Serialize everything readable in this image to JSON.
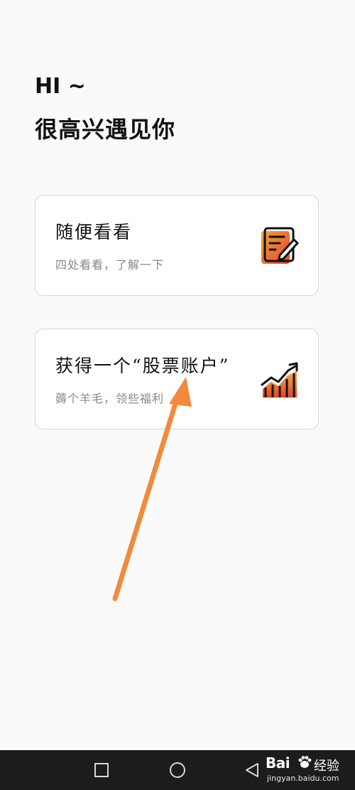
{
  "header": {
    "greeting": "HI ~",
    "title": "很高兴遇见你"
  },
  "cards": [
    {
      "title": "随便看看",
      "subtitle": "四处看看，了解一下",
      "icon": "edit-note-icon"
    },
    {
      "title": "获得一个“股票账户”",
      "subtitle": "薅个羊毛，领些福利",
      "icon": "trending-chart-icon"
    }
  ],
  "annotation": {
    "icon": "orange-pointer-arrow",
    "color": "#f28a3c"
  },
  "nav_bar": {
    "recent_icon": "square-icon",
    "home_icon": "circle-icon",
    "back_icon": "triangle-back-icon"
  },
  "watermark": {
    "logo": "Bai",
    "logo_suffix": "经验",
    "url": "jingyan.baidu.com"
  },
  "colors": {
    "background": "#fafafa",
    "card_border": "#d6d6d6",
    "subtitle": "#888888",
    "accent_orange": "#e8622a",
    "navbar": "#1c1c1f"
  }
}
